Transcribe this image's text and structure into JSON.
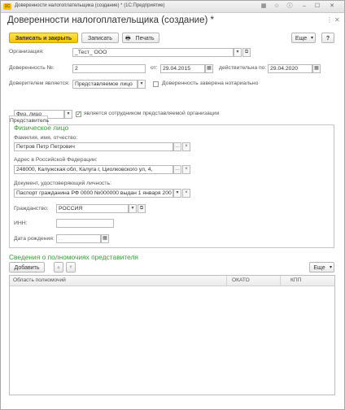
{
  "window": {
    "title": "Доверенности налогоплательщика (создание) * (1С:Предприятие)",
    "app_badge": "1С"
  },
  "form": {
    "title": "Доверенности налогоплательщика (создание) *"
  },
  "toolbar": {
    "save_close": "Записать и закрыть",
    "save": "Записать",
    "print": "Печать",
    "more": "Еще",
    "help": "?"
  },
  "fields": {
    "org_label": "Организация:",
    "org_value": "_Тест_ ООО",
    "num_label": "Доверенность №:",
    "num_value": "2",
    "from_label": "от:",
    "from_value": "29.04.2015",
    "valid_label": "действительна по:",
    "valid_value": "29.04.2020",
    "trustor_label": "Доверителем является:",
    "trustor_value": "Представляемое лицо",
    "notary_label": "Доверенность заверена нотариально"
  },
  "tab": {
    "label": "Представитель"
  },
  "rep": {
    "type_value": "Физ. лицо",
    "employee_label": "является сотрудником представляемой организации",
    "section_title": "Физическое лицо",
    "fio_label": "Фамилия, имя, отчество:",
    "fio_value": "Петров Петр Петрович",
    "address_label": "Адрес в Российской Федерации:",
    "address_value": "248000, Калужская обл, Калуга г, Циолковского ул, 4,",
    "doc_label": "Документ, удостоверяющий личность:",
    "doc_value": "Паспорт гражданина РФ 0000 №000000 выдан 1 января 200",
    "citizenship_label": "Гражданство:",
    "citizenship_value": "РОССИЯ",
    "inn_label": "ИНН:",
    "inn_value": "",
    "birth_label": "Дата рождения:",
    "birth_placeholder": " .  .    "
  },
  "powers": {
    "title": "Сведения о полномочиях представителя",
    "add": "Добавить",
    "more": "Еще",
    "columns": [
      "Область полномочий",
      "ОКАТО",
      "КПП"
    ]
  },
  "icons": {
    "dropdown": "▾",
    "open": "⧉",
    "clear": "×",
    "select": "…",
    "calendar": "▦",
    "up": "▲",
    "down": "▼",
    "check": "✓",
    "print": "🖶"
  }
}
